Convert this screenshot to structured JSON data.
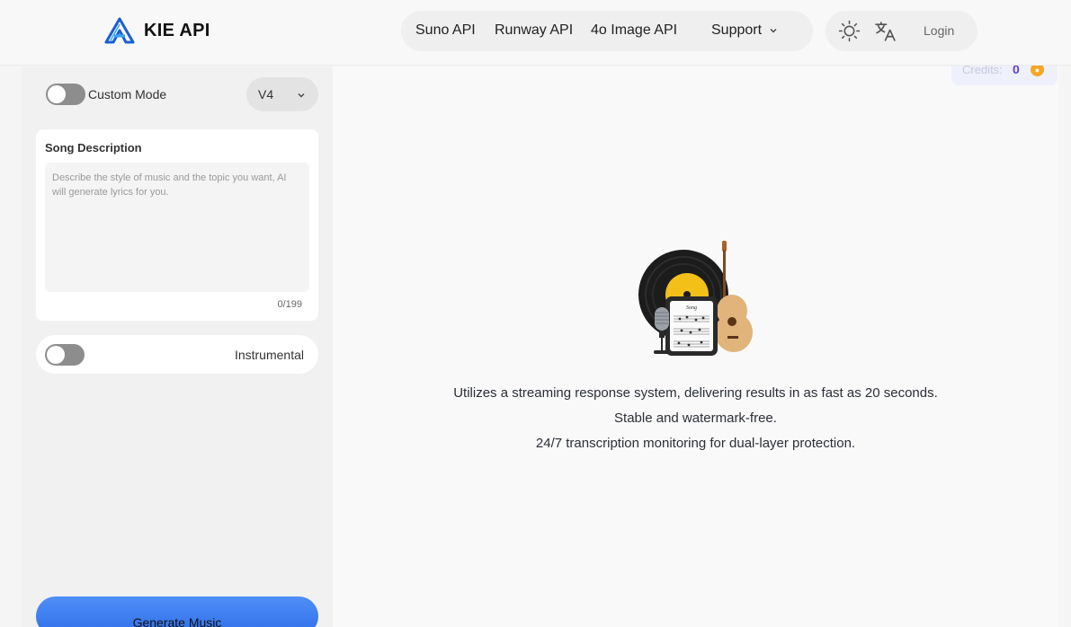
{
  "header": {
    "brand": "KIE API",
    "nav": [
      {
        "label": "Suno API"
      },
      {
        "label": "Runway API"
      },
      {
        "label": "4o Image API"
      },
      {
        "label": "Support"
      }
    ],
    "login_label": "Login",
    "icons": [
      "sun-icon",
      "translate-icon",
      "chevron-down-icon"
    ]
  },
  "credits": {
    "label": "Credits:",
    "value": "0"
  },
  "left_panel": {
    "custom_mode_label": "Custom Mode",
    "custom_mode_on": false,
    "version": "V4",
    "song_description": {
      "title": "Song Description",
      "value": "",
      "placeholder": "Describe the style of music and the topic you want, AI will generate lyrics for you.",
      "counter": "0/199"
    },
    "instrumental_label": "Instrumental",
    "instrumental_on": false,
    "generate_label": "Generate Music"
  },
  "main": {
    "illustration_label": "Song",
    "messages": [
      "Utilizes a streaming response system, delivering results in as fast as 20 seconds.",
      "Stable and watermark-free.",
      "24/7 transcription monitoring for dual-layer protection."
    ]
  },
  "colors": {
    "accent": "#2f6fe8",
    "credits_value": "#5b3fd6",
    "coin": "#f5a623",
    "toggle_off": "#8d8d8d"
  }
}
